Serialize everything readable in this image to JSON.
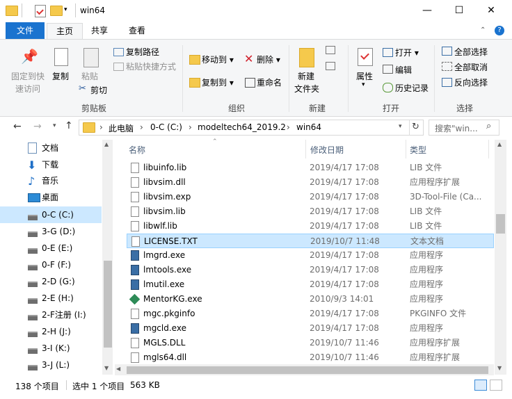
{
  "window": {
    "title": "win64",
    "controls": {
      "minimize": "—",
      "maximize": "☐",
      "close": "✕"
    }
  },
  "tabs": [
    "文件",
    "主页",
    "共享",
    "查看"
  ],
  "ribbon": {
    "clipboard": {
      "pin_label_1": "固定到快",
      "pin_label_2": "速访问",
      "copy": "复制",
      "paste": "粘贴",
      "copy_path": "复制路径",
      "paste_shortcut": "粘贴快捷方式",
      "cut": "剪切",
      "group": "剪贴板"
    },
    "organize": {
      "move_to": "移动到",
      "copy_to": "复制到",
      "delete": "删除",
      "rename": "重命名",
      "group": "组织"
    },
    "new": {
      "new_folder_1": "新建",
      "new_folder_2": "文件夹",
      "group": "新建"
    },
    "open": {
      "properties": "属性",
      "open": "打开",
      "edit": "编辑",
      "history": "历史记录",
      "group": "打开"
    },
    "select": {
      "select_all": "全部选择",
      "select_none": "全部取消",
      "invert": "反向选择",
      "group": "选择"
    }
  },
  "address": {
    "crumbs": [
      "此电脑",
      "0-C (C:)",
      "modeltech64_2019.2",
      "win64"
    ],
    "search_placeholder": "搜索\"win..."
  },
  "nav": {
    "items": [
      {
        "label": "文档",
        "icon": "documents-icon"
      },
      {
        "label": "下载",
        "icon": "download-icon"
      },
      {
        "label": "音乐",
        "icon": "music-icon"
      },
      {
        "label": "桌面",
        "icon": "desktop-icon"
      },
      {
        "label": "0-C (C:)",
        "icon": "drive-icon",
        "selected": true
      },
      {
        "label": "3-G (D:)",
        "icon": "drive-icon"
      },
      {
        "label": "0-E (E:)",
        "icon": "drive-icon"
      },
      {
        "label": "0-F (F:)",
        "icon": "drive-icon"
      },
      {
        "label": "2-D (G:)",
        "icon": "drive-icon"
      },
      {
        "label": "2-E (H:)",
        "icon": "drive-icon"
      },
      {
        "label": "2-F注册 (I:)",
        "icon": "drive-icon"
      },
      {
        "label": "2-H (J:)",
        "icon": "drive-icon"
      },
      {
        "label": "3-I (K:)",
        "icon": "drive-icon"
      },
      {
        "label": "3-J (L:)",
        "icon": "drive-icon"
      }
    ]
  },
  "columns": {
    "name": "名称",
    "date": "修改日期",
    "type": "类型"
  },
  "files": [
    {
      "name": "libuinfo.lib",
      "date": "2019/4/17 17:08",
      "type": "LIB 文件",
      "icon": "doc"
    },
    {
      "name": "libvsim.dll",
      "date": "2019/4/17 17:08",
      "type": "应用程序扩展",
      "icon": "gear"
    },
    {
      "name": "libvsim.exp",
      "date": "2019/4/17 17:08",
      "type": "3D-Tool-File (Ca...",
      "icon": "doc"
    },
    {
      "name": "libvsim.lib",
      "date": "2019/4/17 17:08",
      "type": "LIB 文件",
      "icon": "doc"
    },
    {
      "name": "libwlf.lib",
      "date": "2019/4/17 17:08",
      "type": "LIB 文件",
      "icon": "doc"
    },
    {
      "name": "LICENSE.TXT",
      "date": "2019/10/7 11:48",
      "type": "文本文档",
      "icon": "doc",
      "selected": true
    },
    {
      "name": "lmgrd.exe",
      "date": "2019/4/17 17:08",
      "type": "应用程序",
      "icon": "exe"
    },
    {
      "name": "lmtools.exe",
      "date": "2019/4/17 17:08",
      "type": "应用程序",
      "icon": "exe"
    },
    {
      "name": "lmutil.exe",
      "date": "2019/4/17 17:08",
      "type": "应用程序",
      "icon": "exe"
    },
    {
      "name": "MentorKG.exe",
      "date": "2010/9/3 14:01",
      "type": "应用程序",
      "icon": "mentor"
    },
    {
      "name": "mgc.pkginfo",
      "date": "2019/4/17 17:08",
      "type": "PKGINFO 文件",
      "icon": "doc"
    },
    {
      "name": "mgcld.exe",
      "date": "2019/4/17 17:08",
      "type": "应用程序",
      "icon": "exe"
    },
    {
      "name": "MGLS.DLL",
      "date": "2019/10/7 11:46",
      "type": "应用程序扩展",
      "icon": "gear"
    },
    {
      "name": "mgls64.dll",
      "date": "2019/10/7 11:46",
      "type": "应用程序扩展",
      "icon": "gear"
    }
  ],
  "status": {
    "count": "138 个项目",
    "selected": "选中 1 个项目",
    "size": "563 KB"
  },
  "colors": {
    "accent": "#1a73cf",
    "selection": "#cce8ff",
    "folder": "#f5c94c"
  }
}
